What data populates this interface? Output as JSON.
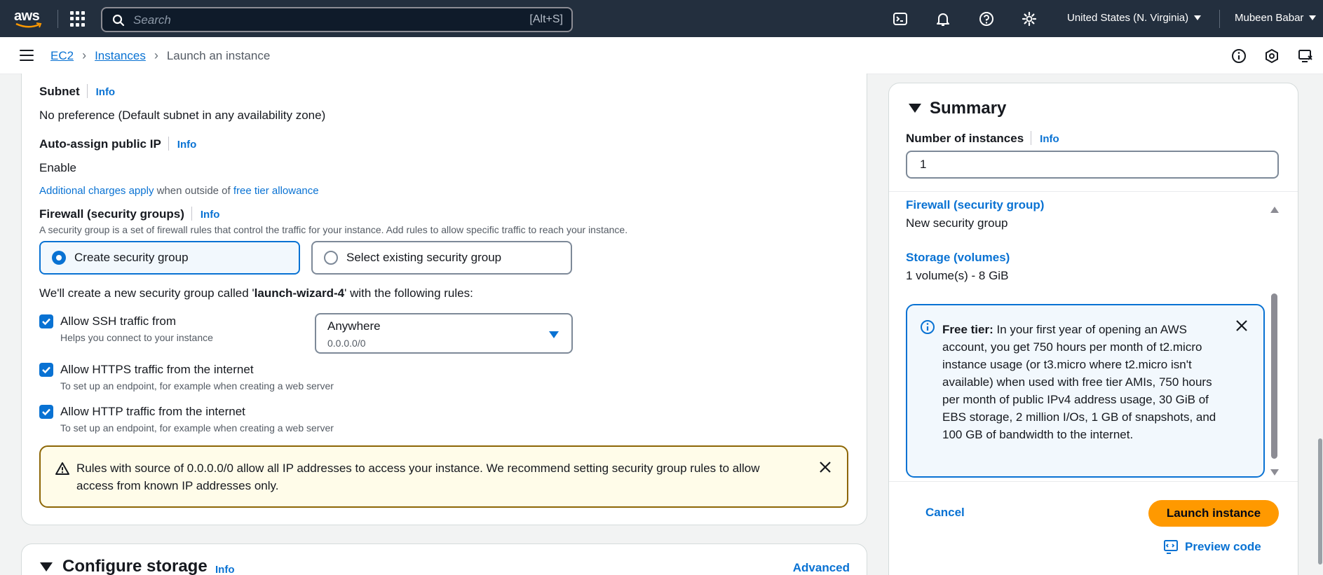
{
  "topnav": {
    "logo_text": "aws",
    "search_placeholder": "Search",
    "search_shortcut": "[Alt+S]",
    "region": "United States (N. Virginia)",
    "user": "Mubeen Babar"
  },
  "breadcrumb": {
    "items": [
      "EC2",
      "Instances"
    ],
    "current": "Launch an instance"
  },
  "network": {
    "subnet_label": "Subnet",
    "subnet_value": "No preference (Default subnet in any availability zone)",
    "auto_ip_label": "Auto-assign public IP",
    "auto_ip_value": "Enable",
    "charges_link": "Additional charges apply",
    "charges_mid": " when outside of ",
    "charges_link2": "free tier allowance",
    "info": "Info"
  },
  "firewall": {
    "label": "Firewall (security groups)",
    "description": "A security group is a set of firewall rules that control the traffic for your instance. Add rules to allow specific traffic to reach your instance.",
    "option_create": "Create security group",
    "option_existing": "Select existing security group",
    "create_text_prefix": "We'll create a new security group called '",
    "group_name": "launch-wizard-4",
    "create_text_suffix": "' with the following rules:",
    "rules": [
      {
        "label": "Allow SSH traffic from",
        "help": "Helps you connect to your instance",
        "checked": true
      },
      {
        "label": "Allow HTTPS traffic from the internet",
        "help": "To set up an endpoint, for example when creating a web server",
        "checked": true
      },
      {
        "label": "Allow HTTP traffic from the internet",
        "help": "To set up an endpoint, for example when creating a web server",
        "checked": true
      }
    ],
    "ssh_source": "Anywhere",
    "ssh_source_cidr": "0.0.0.0/0",
    "warning": "Rules with source of 0.0.0.0/0 allow all IP addresses to access your instance. We recommend setting security group rules to allow access from known IP addresses only."
  },
  "storage_section": {
    "title": "Configure storage",
    "info": "Info",
    "advanced": "Advanced"
  },
  "summary": {
    "title": "Summary",
    "num_instances_label": "Number of instances",
    "info": "Info",
    "num_instances_value": "1",
    "firewall_label": "Firewall (security group)",
    "firewall_value": "New security group",
    "storage_label": "Storage (volumes)",
    "storage_value": "1 volume(s) - 8 GiB",
    "free_tier_bold": "Free tier:",
    "free_tier_text": " In your first year of opening an AWS account, you get 750 hours per month of t2.micro instance usage (or t3.micro where t2.micro isn't available) when used with free tier AMIs, 750 hours per month of public IPv4 address usage, 30 GiB of EBS storage, 2 million I/Os, 1 GB of snapshots, and 100 GB of bandwidth to the internet.",
    "cancel": "Cancel",
    "launch": "Launch instance",
    "preview": "Preview code"
  },
  "colors": {
    "nav_bg": "#232f3e",
    "link": "#0972d3",
    "primary": "#ff9900",
    "warning_border": "#8d6605",
    "warning_bg": "#fffce9",
    "info_bg": "#f2f8fd"
  }
}
